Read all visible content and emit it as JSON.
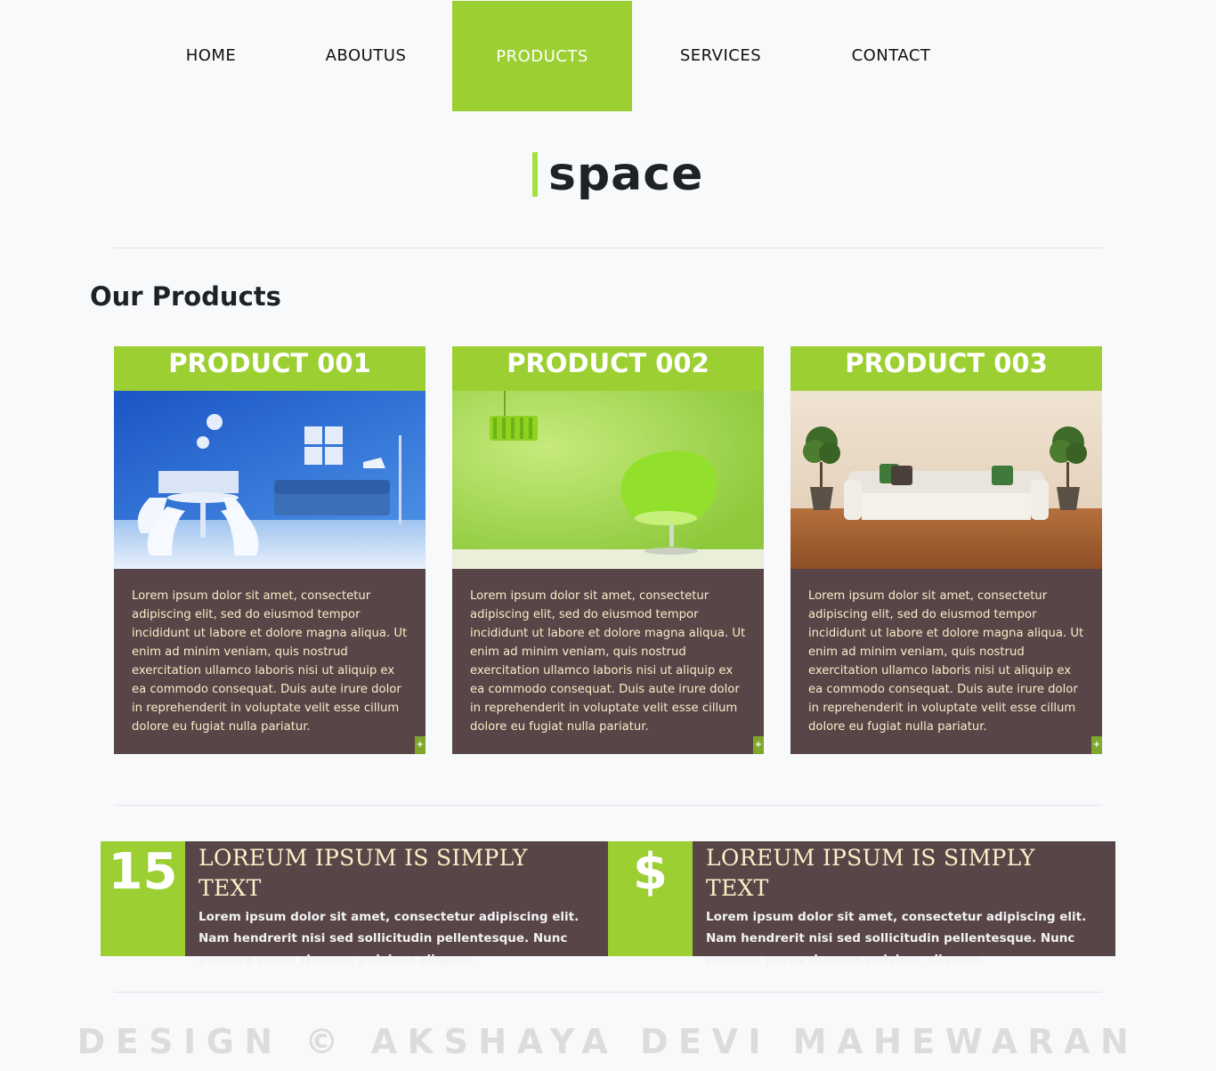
{
  "nav": {
    "items": [
      {
        "label": "HOME"
      },
      {
        "label": "ABOUTUS"
      },
      {
        "label": "PRODUCTS",
        "active": true
      },
      {
        "label": "SERVICES"
      },
      {
        "label": "CONTACT"
      }
    ]
  },
  "logo": {
    "text": "space"
  },
  "section": {
    "title": "Our Products"
  },
  "products": [
    {
      "title": "PRODUCT 001",
      "image_icon": "blue-living-room-image",
      "description": "Lorem ipsum dolor sit amet, consectetur adipiscing elit, sed do eiusmod tempor incididunt ut labore et dolore magna aliqua. Ut enim ad minim veniam, quis nostrud exercitation ullamco laboris nisi ut aliquip ex ea commodo consequat. Duis aute irure dolor in reprehenderit in voluptate velit esse cillum dolore eu fugiat nulla pariatur.",
      "more": "+"
    },
    {
      "title": "PRODUCT 002",
      "image_icon": "green-chair-room-image",
      "description": "Lorem ipsum dolor sit amet, consectetur adipiscing elit, sed do eiusmod tempor incididunt ut labore et dolore magna aliqua. Ut enim ad minim veniam, quis nostrud exercitation ullamco laboris nisi ut aliquip ex ea commodo consequat. Duis aute irure dolor in reprehenderit in voluptate velit esse cillum dolore eu fugiat nulla pariatur.",
      "more": "+"
    },
    {
      "title": "PRODUCT 003",
      "image_icon": "sofa-room-image",
      "description": "Lorem ipsum dolor sit amet, consectetur adipiscing elit, sed do eiusmod tempor incididunt ut labore et dolore magna aliqua. Ut enim ad minim veniam, quis nostrud exercitation ullamco laboris nisi ut aliquip ex ea commodo consequat. Duis aute irure dolor in reprehenderit in voluptate velit esse cillum dolore eu fugiat nulla pariatur.",
      "more": "+"
    }
  ],
  "features": [
    {
      "badge": "15",
      "title": "LOREUM IPSUM IS SIMPLY TEXT",
      "text": "Lorem ipsum dolor sit amet, consectetur adipiscing elit. Nam hendrerit nisi sed sollicitudin pellentesque. Nunc posuere purus rhoncus pulvinar aliquam."
    },
    {
      "badge": "$",
      "title": "LOREUM IPSUM IS SIMPLY TEXT",
      "text": "Lorem ipsum dolor sit amet, consectetur adipiscing elit. Nam hendrerit nisi sed sollicitudin pellentesque. Nunc posuere purus rhoncus pulvinar aliquam."
    }
  ],
  "footer": {
    "text": "DESIGN © AKSHAYA DEVI MAHEWARAN"
  },
  "colors": {
    "accent_green": "#9ccf32",
    "card_brown": "#574547",
    "logo_bar": "#a4e43a",
    "body_text_cream": "#f5eec8",
    "footer_gray": "#dcdcdc"
  }
}
